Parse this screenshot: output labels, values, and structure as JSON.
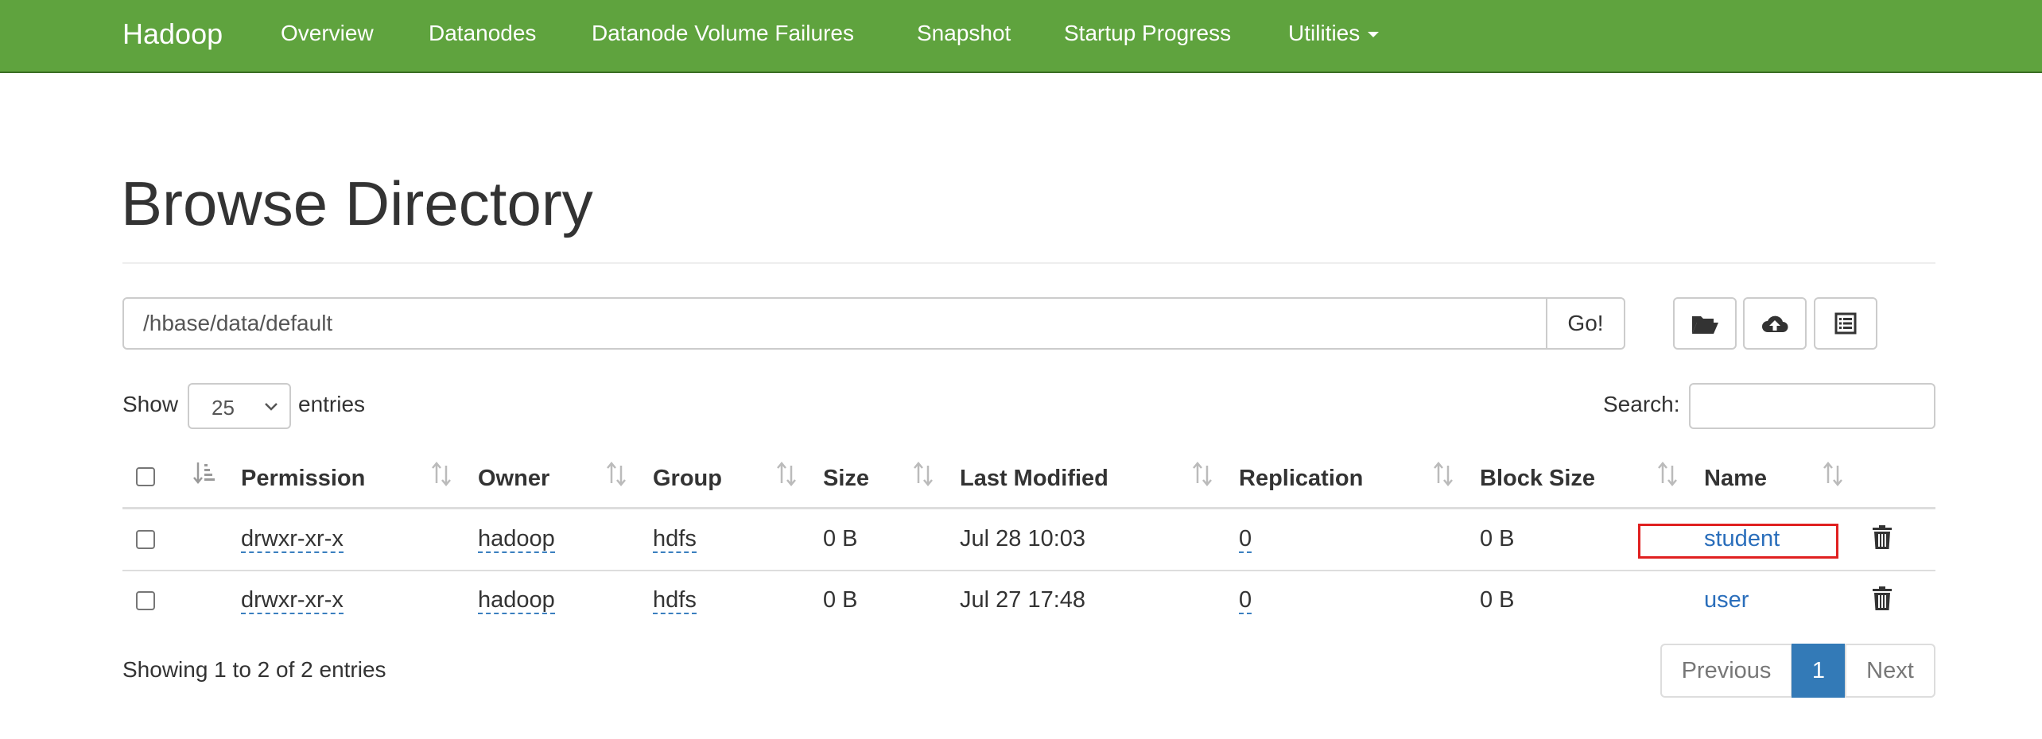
{
  "navbar": {
    "brand": "Hadoop",
    "items": [
      "Overview",
      "Datanodes",
      "Datanode Volume Failures",
      "Snapshot",
      "Startup Progress",
      "Utilities"
    ],
    "color": "#5fa33e"
  },
  "page": {
    "title": "Browse Directory"
  },
  "path_bar": {
    "value": "/hbase/data/default",
    "go_label": "Go!",
    "tools": [
      "folder-open-icon",
      "cloud-upload-icon",
      "list-alt-icon"
    ]
  },
  "table_controls": {
    "show_label": "Show",
    "page_length": "25",
    "entries_label": "entries",
    "search_label": "Search:",
    "search_value": ""
  },
  "table": {
    "columns": [
      "Permission",
      "Owner",
      "Group",
      "Size",
      "Last Modified",
      "Replication",
      "Block Size",
      "Name"
    ],
    "rows": [
      {
        "permission": "drwxr-xr-x",
        "owner": "hadoop",
        "group": "hdfs",
        "size": "0 B",
        "last_modified": "Jul 28 10:03",
        "replication": "0",
        "block_size": "0 B",
        "name": "student",
        "highlighted": true
      },
      {
        "permission": "drwxr-xr-x",
        "owner": "hadoop",
        "group": "hdfs",
        "size": "0 B",
        "last_modified": "Jul 27 17:48",
        "replication": "0",
        "block_size": "0 B",
        "name": "user",
        "highlighted": false
      }
    ]
  },
  "footer": {
    "info": "Showing 1 to 2 of 2 entries",
    "previous_label": "Previous",
    "current_page": "1",
    "next_label": "Next"
  },
  "colors": {
    "link": "#2a6ebb",
    "active_page": "#337ab7",
    "highlight": "#e02020"
  }
}
